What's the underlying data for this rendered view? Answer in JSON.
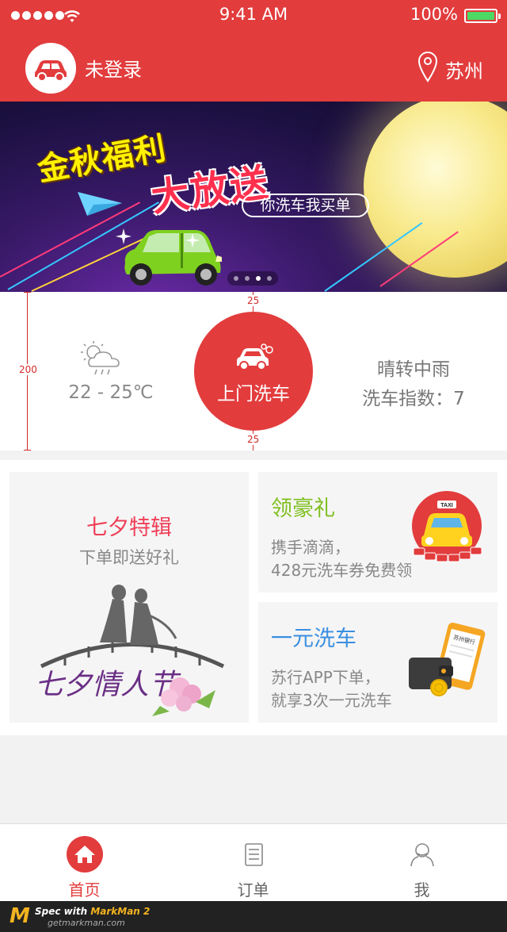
{
  "status_bar": {
    "time": "9:41 AM",
    "battery": "100%",
    "battery_level": 1.0
  },
  "header": {
    "login_status": "未登录",
    "city": "苏州"
  },
  "banner": {
    "title_line1": "金秋福利",
    "title_line2": "大放送",
    "tagline": "你洗车我买单",
    "slide_count": 4,
    "active_slide": 3
  },
  "weather": {
    "temperature": "22 - 25℃",
    "condition": "晴转中雨",
    "wash_index": "洗车指数：7",
    "wash_button": "上门洗车"
  },
  "annotations": {
    "panel_height": "200",
    "top_gap": "25",
    "bottom_gap": "25"
  },
  "promos": {
    "qixi": {
      "title": "七夕特辑",
      "subtitle": "下单即送好礼",
      "art_text": "七夕情人节"
    },
    "gift": {
      "title": "领豪礼",
      "desc_line1": "携手滴滴，",
      "desc_line2": "428元洗车券免费领",
      "badge": "TAXI"
    },
    "wash1": {
      "title": "一元洗车",
      "desc_line1": "苏行APP下单，",
      "desc_line2": "就享3次一元洗车",
      "phone_text": "苏州银行"
    }
  },
  "colors": {
    "brand_red": "#e23c3d",
    "qixi_red": "#ef3f57",
    "gift_green": "#7fbf1f",
    "wash_blue": "#3a8fe0"
  },
  "tabs": [
    {
      "label": "首页",
      "icon": "home-icon",
      "active": true
    },
    {
      "label": "订单",
      "icon": "order-list-icon",
      "active": false
    },
    {
      "label": "我",
      "icon": "user-icon",
      "active": false
    }
  ],
  "watermark": {
    "line1_prefix": "Spec with ",
    "line1_brand": "MarkMan 2",
    "url": "getmarkman.com",
    "logo": "M"
  }
}
